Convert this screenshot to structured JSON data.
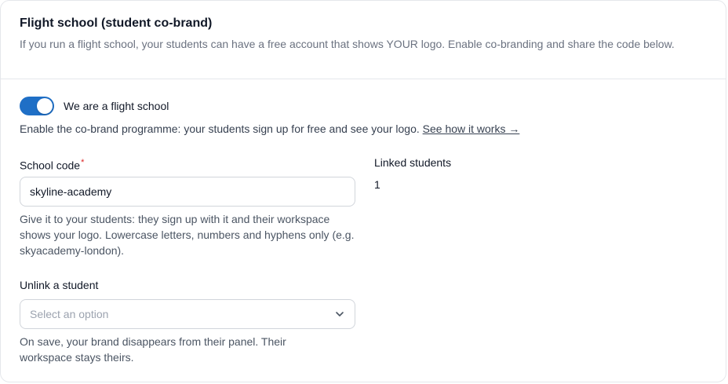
{
  "section": {
    "title": "Flight school (student co-brand)",
    "subtitle": "If you run a flight school, your students can have a free account that shows YOUR logo. Enable co-branding and share the code below."
  },
  "toggle": {
    "label": "We are a flight school",
    "enabled": true,
    "description": "Enable the co-brand programme: your students sign up for free and see your logo.",
    "link_text": "See how it works →",
    "color": "#1f6fc6"
  },
  "school_code": {
    "label": "School code",
    "required_mark": "*",
    "value": "skyline-academy",
    "hint": "Give it to your students: they sign up with it and their workspace shows your logo. Lowercase letters, numbers and hyphens only (e.g. skyacademy-london)."
  },
  "linked_students": {
    "label": "Linked students",
    "count": "1"
  },
  "unlink": {
    "label": "Unlink a student",
    "placeholder": "Select an option",
    "icon": "chevron-down-icon",
    "hint": "On save, your brand disappears from their panel. Their workspace stays theirs."
  }
}
